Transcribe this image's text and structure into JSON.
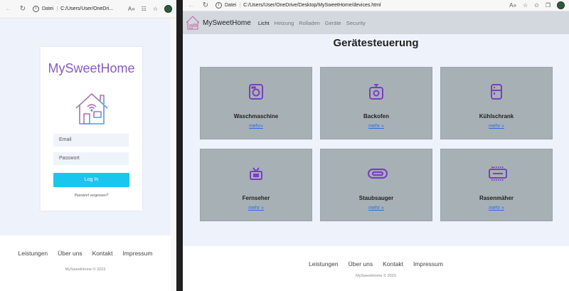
{
  "left_window": {
    "browser": {
      "address_label": "Datei",
      "url": "C:/Users/User/OneDri..."
    },
    "brand": "MySweetHome",
    "form": {
      "email_placeholder": "Email",
      "password_placeholder": "Passwort",
      "login_label": "Log In",
      "forgot_label": "Passwort vergessen?"
    },
    "footer": {
      "links": [
        "Leistungen",
        "Über uns",
        "Kontakt",
        "Impressum"
      ],
      "copyright": "MySweetHome © 2023"
    }
  },
  "right_window": {
    "browser": {
      "address_label": "Datei",
      "url": "C:/Users/User/OneDrive/Desktop/MySweetHome/devices.html"
    },
    "nav": {
      "brand": "MySweetHome",
      "links": [
        "Licht",
        "Heizung",
        "Rolladen",
        "Geräte",
        "Security"
      ]
    },
    "title": "Gerätesteuerung",
    "devices": [
      {
        "name": "Waschmaschine",
        "link": "mehr»",
        "icon": "washing-machine-icon"
      },
      {
        "name": "Backofen",
        "link": "mehr »",
        "icon": "oven-icon"
      },
      {
        "name": "Kühlschrank",
        "link": "mehr »",
        "icon": "fridge-icon"
      },
      {
        "name": "Fernseher",
        "link": "mehr »",
        "icon": "tv-icon"
      },
      {
        "name": "Staubsauger",
        "link": "mehr »",
        "icon": "vacuum-icon"
      },
      {
        "name": "Rasenmäher",
        "link": "mehr »",
        "icon": "lawnmower-icon"
      }
    ],
    "footer": {
      "links": [
        "Leistungen",
        "Über uns",
        "Kontakt",
        "Impressum"
      ],
      "copyright": "MySweetHome © 2023"
    }
  },
  "colors": {
    "brand_purple": "#8a5cbd",
    "login_button": "#19c6ee",
    "card_bg": "#a7b1b5",
    "link_blue": "#2b6de0"
  }
}
